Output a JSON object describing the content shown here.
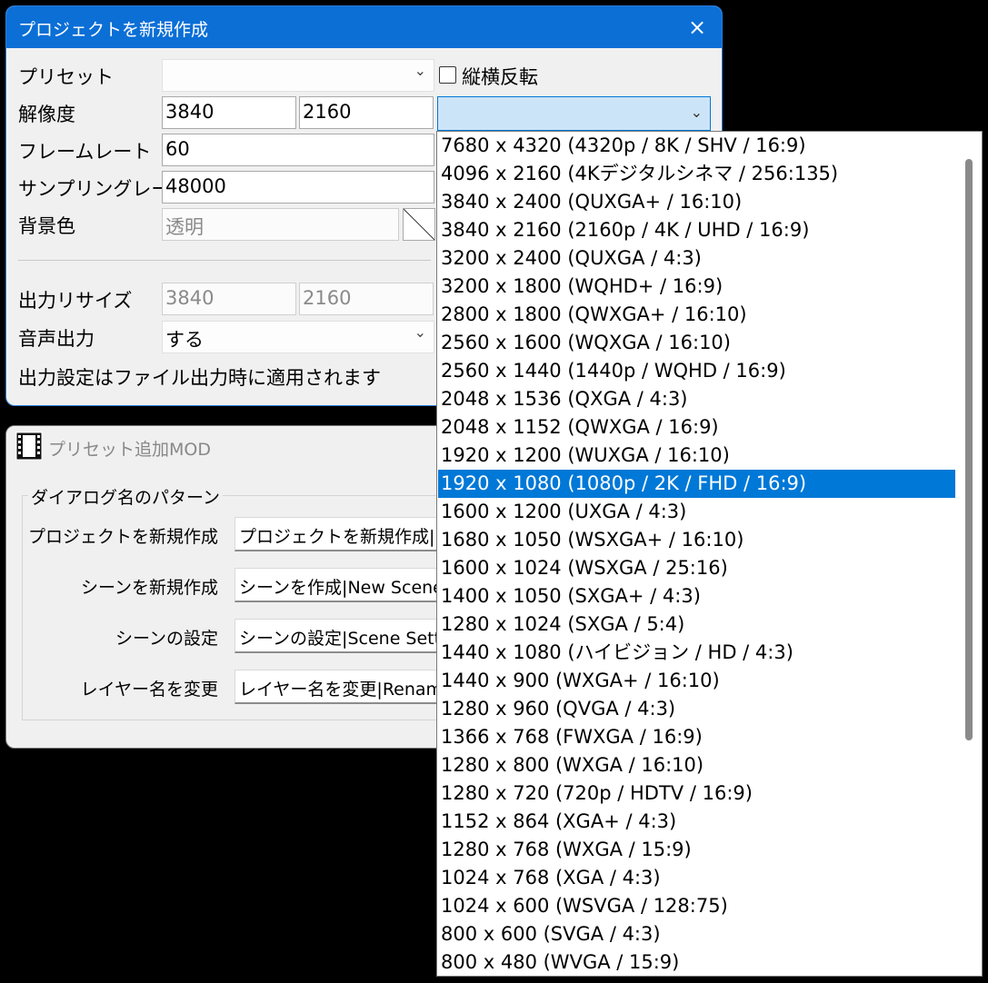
{
  "dialog1": {
    "title": "プロジェクトを新規作成",
    "close_icon": "×",
    "preset_label": "プリセット",
    "flip_checkbox_label": "縦横反転",
    "flip_checked": false,
    "resolution_label": "解像度",
    "resolution_width": "3840",
    "resolution_height": "2160",
    "framerate_label": "フレームレート",
    "framerate_value": "60",
    "samplerate_label": "サンプリングレート",
    "samplerate_value": "48000",
    "bgcolor_label": "背景色",
    "bgcolor_value": "透明",
    "output_resize_label": "出力リサイズ",
    "output_width": "3840",
    "output_height": "2160",
    "audio_output_label": "音声出力",
    "audio_output_value": "する",
    "note": "出力設定はファイル出力時に適用されます"
  },
  "dialog2": {
    "title": "プリセット追加MOD",
    "app_icon": "film-icon",
    "group_label": "ダイアログ名のパターン",
    "rows": [
      {
        "label": "プロジェクトを新規作成",
        "value": "プロジェクトを新規作成|New"
      },
      {
        "label": "シーンを新規作成",
        "value": "シーンを作成|New Scene"
      },
      {
        "label": "シーンの設定",
        "value": "シーンの設定|Scene Sett"
      },
      {
        "label": "レイヤー名を変更",
        "value": "レイヤー名を変更|Renam"
      }
    ]
  },
  "dropdown": {
    "selected_index": 12,
    "items": [
      "7680 x 4320 (4320p / 8K / SHV / 16:9)",
      "4096 x 2160 (4Kデジタルシネマ / 256:135)",
      "3840 x 2400 (QUXGA+ / 16:10)",
      "3840 x 2160 (2160p / 4K / UHD / 16:9)",
      "3200 x 2400 (QUXGA / 4:3)",
      "3200 x 1800 (WQHD+ / 16:9)",
      "2800 x 1800 (QWXGA+ / 16:10)",
      "2560 x 1600 (WQXGA / 16:10)",
      "2560 x 1440 (1440p / WQHD / 16:9)",
      "2048 x 1536 (QXGA / 4:3)",
      "2048 x 1152 (QWXGA / 16:9)",
      "1920 x 1200 (WUXGA / 16:10)",
      "1920 x 1080 (1080p / 2K / FHD / 16:9)",
      "1600 x 1200 (UXGA / 4:3)",
      "1680 x 1050 (WSXGA+ / 16:10)",
      "1600 x 1024 (WSXGA / 25:16)",
      "1400 x 1050 (SXGA+ / 4:3)",
      "1280 x 1024 (SXGA / 5:4)",
      "1440 x 1080 (ハイビジョン / HD / 4:3)",
      "1440 x 900 (WXGA+ / 16:10)",
      "1280 x 960 (QVGA / 4:3)",
      "1366 x 768 (FWXGA / 16:9)",
      "1280 x 800 (WXGA / 16:10)",
      "1280 x 720 (720p / HDTV / 16:9)",
      "1152 x 864 (XGA+ / 4:3)",
      "1280 x 768 (WXGA / 15:9)",
      "1024 x 768 (XGA / 4:3)",
      "1024 x 600 (WSVGA / 128:75)",
      "800 x 600 (SVGA / 4:3)",
      "800 x 480 (WVGA / 15:9)"
    ]
  }
}
